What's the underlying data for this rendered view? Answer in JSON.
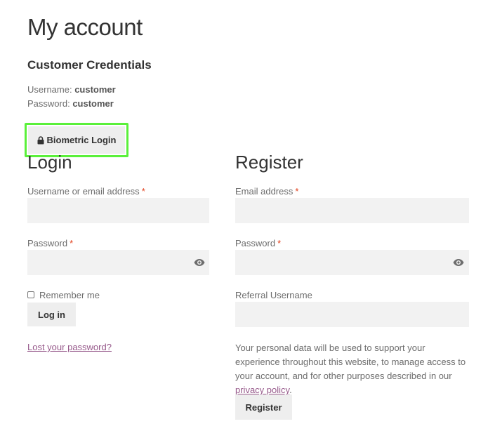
{
  "page": {
    "title": "My account"
  },
  "credentials": {
    "heading": "Customer Credentials",
    "username_label": "Username:",
    "username_value": "customer",
    "password_label": "Password:",
    "password_value": "customer"
  },
  "biometric": {
    "label": "Biometric Login",
    "icon": "lock-icon",
    "highlight_color": "#5af03a"
  },
  "login": {
    "title": "Login",
    "username_label": "Username or email address",
    "password_label": "Password",
    "required_mark": "*",
    "remember_label": "Remember me",
    "submit_label": "Log in",
    "lost_password_link": "Lost your password?"
  },
  "register": {
    "title": "Register",
    "email_label": "Email address",
    "password_label": "Password",
    "required_mark": "*",
    "referral_label": "Referral Username",
    "privacy_before": "Your personal data will be used to support your experience throughout this website, to manage access to your account, and for other purposes described in our ",
    "privacy_link": "privacy policy",
    "privacy_after": ".",
    "submit_label": "Register"
  },
  "colors": {
    "link": "#96588a",
    "required": "#e2401c",
    "field_bg": "#f2f2f2",
    "button_bg": "#eeeeee"
  }
}
